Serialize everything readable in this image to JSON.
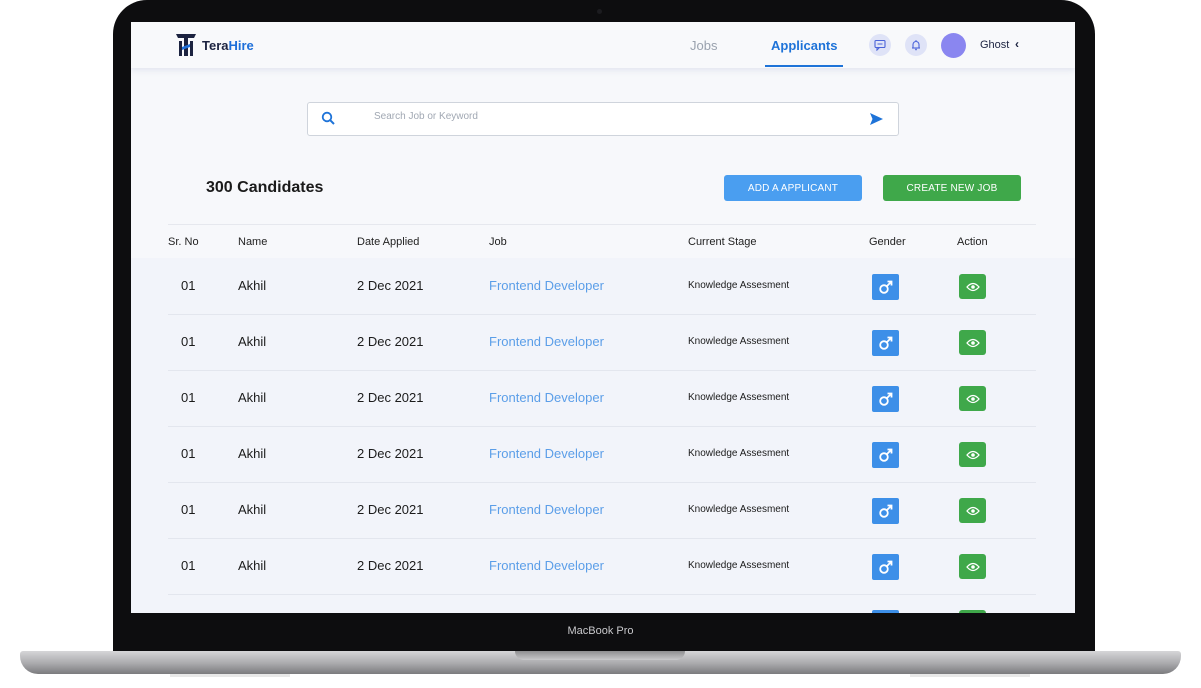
{
  "device": {
    "label": "MacBook Pro"
  },
  "header": {
    "brand_prefix": "Tera",
    "brand_suffix": "Hire",
    "nav": [
      {
        "label": "Jobs"
      },
      {
        "label": "Applicants"
      }
    ],
    "user": {
      "name": "Ghost"
    }
  },
  "search": {
    "placeholder": "Search Job or Keyword",
    "value": ""
  },
  "summary": {
    "candidates": "300 Candidates"
  },
  "actions": {
    "add_applicant": "ADD A APPLICANT",
    "create_job": "CREATE NEW JOB"
  },
  "table": {
    "columns": [
      "Sr. No",
      "Name",
      "Date Applied",
      "Job",
      "Current Stage",
      "Gender",
      "Action"
    ],
    "rows": [
      {
        "sr": "01",
        "name": "Akhil",
        "date": "2 Dec 2021",
        "job": "Frontend Developer",
        "stage": "Knowledge Assesment",
        "gender": "male"
      },
      {
        "sr": "01",
        "name": "Akhil",
        "date": "2 Dec 2021",
        "job": "Frontend Developer",
        "stage": "Knowledge Assesment",
        "gender": "male"
      },
      {
        "sr": "01",
        "name": "Akhil",
        "date": "2 Dec 2021",
        "job": "Frontend Developer",
        "stage": "Knowledge Assesment",
        "gender": "male"
      },
      {
        "sr": "01",
        "name": "Akhil",
        "date": "2 Dec 2021",
        "job": "Frontend Developer",
        "stage": "Knowledge Assesment",
        "gender": "male"
      },
      {
        "sr": "01",
        "name": "Akhil",
        "date": "2 Dec 2021",
        "job": "Frontend Developer",
        "stage": "Knowledge Assesment",
        "gender": "male"
      },
      {
        "sr": "01",
        "name": "Akhil",
        "date": "2 Dec 2021",
        "job": "Frontend Developer",
        "stage": "Knowledge Assesment",
        "gender": "male"
      }
    ]
  },
  "icons": {
    "gender": "male-icon",
    "action": "eye-icon",
    "nav_buttons": [
      "chat-icon",
      "bell-icon"
    ],
    "search": "search-icon",
    "submit": "send-icon"
  },
  "colors": {
    "primary": "#1e73d8",
    "job_link": "#5b9ee8",
    "add_button": "#4a9ef0",
    "create_button": "#3fa84a",
    "gender_badge": "#3d8fe8",
    "view_badge": "#3fa84a",
    "avatar": "#8a86f0"
  }
}
